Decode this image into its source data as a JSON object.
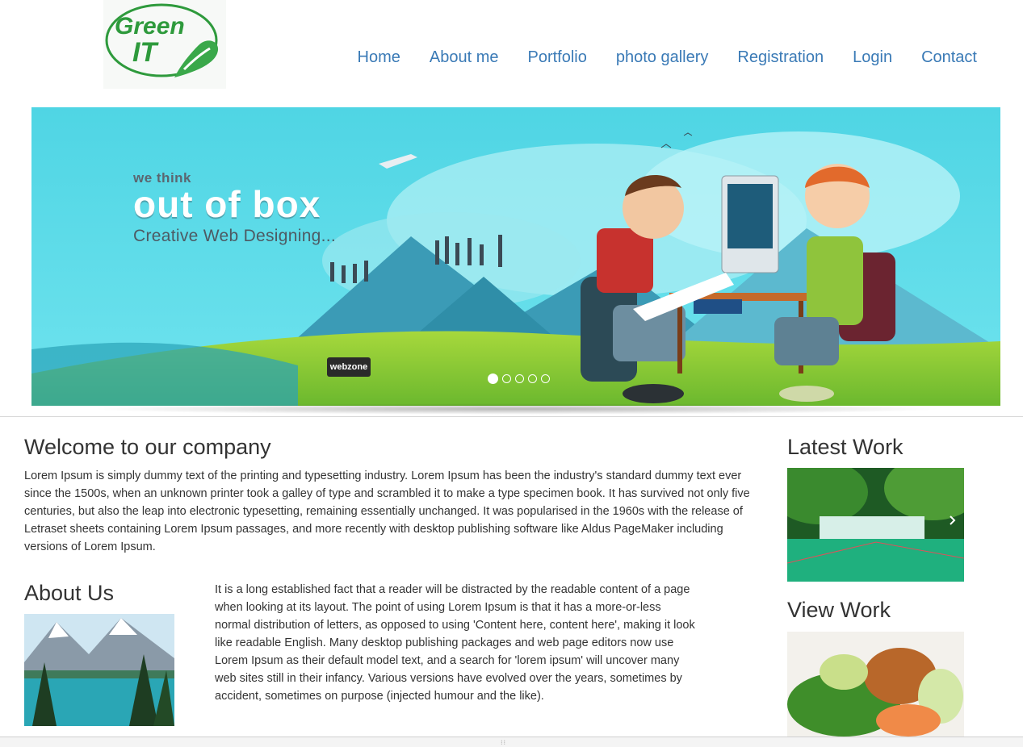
{
  "header": {
    "logo_text_line1": "Green",
    "logo_text_line2": "IT",
    "nav": [
      {
        "label": "Home"
      },
      {
        "label": "About me"
      },
      {
        "label": "Portfolio"
      },
      {
        "label": "photo gallery"
      },
      {
        "label": "Registration"
      },
      {
        "label": "Login"
      },
      {
        "label": "Contact"
      }
    ]
  },
  "banner": {
    "tagline_small": "we think",
    "tagline_big": "out of box",
    "tagline_sub": "Creative Web Designing...",
    "badge": "webzone",
    "slides_total": 5,
    "active_slide": 1
  },
  "welcome": {
    "title": "Welcome to our company",
    "text": "Lorem Ipsum is simply dummy text of the printing and typesetting industry. Lorem Ipsum has been the industry's standard dummy text ever since the 1500s, when an unknown printer took a galley of type and scrambled it to make a type specimen book. It has survived not only five centuries, but also the leap into electronic typesetting, remaining essentially unchanged. It was popularised in the 1960s with the release of Letraset sheets containing Lorem Ipsum passages, and more recently with desktop publishing software like Aldus PageMaker including versions of Lorem Ipsum."
  },
  "about": {
    "title": "About Us",
    "text": "It is a long established fact that a reader will be distracted by the readable content of a page when looking at its layout. The point of using Lorem Ipsum is that it has a more-or-less normal distribution of letters, as opposed to using 'Content here, content here', making it look like readable English. Many desktop publishing packages and web page editors now use Lorem Ipsum as their default model text, and a search for 'lorem ipsum' will uncover many web sites still in their infancy. Various versions have evolved over the years, sometimes by accident, sometimes on purpose (injected humour and the like)."
  },
  "sidebar": {
    "latest_title": "Latest Work",
    "view_title": "View Work"
  },
  "colors": {
    "nav_link": "#3a7ab6",
    "banner_sky": "#4ed7e6",
    "logo_green": "#2e9a3c"
  }
}
